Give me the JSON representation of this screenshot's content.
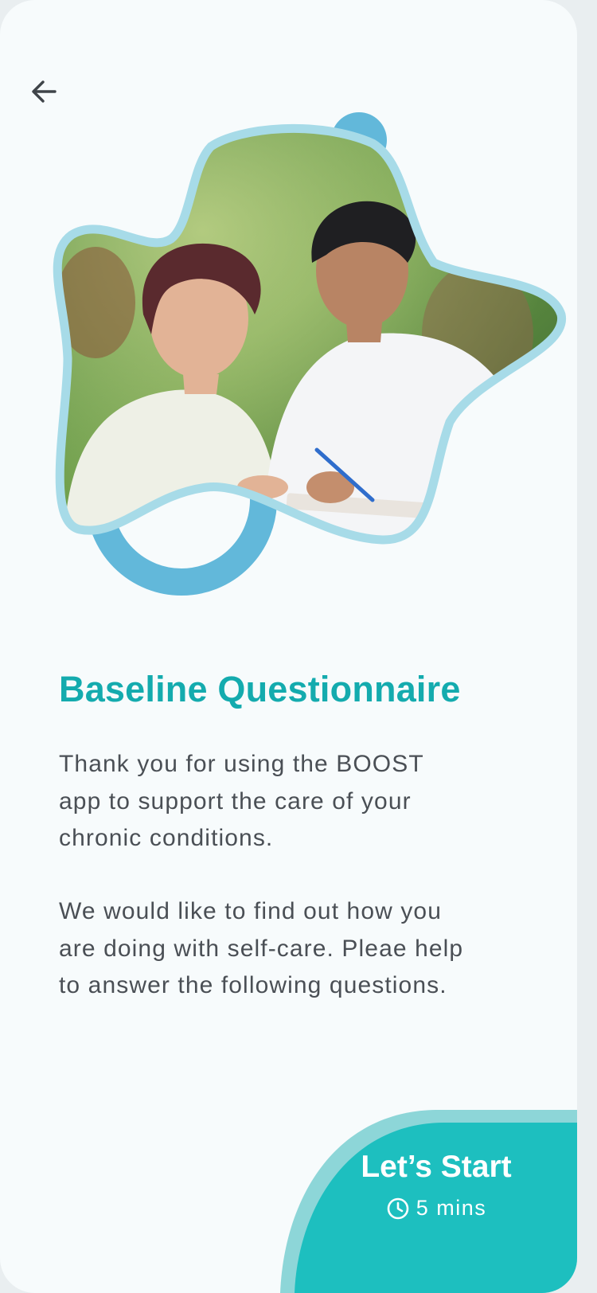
{
  "header": {
    "back_icon": "arrow-left-icon"
  },
  "hero": {
    "image_alt": "Smiling woman and man filling in a questionnaire outdoors"
  },
  "content": {
    "title": "Baseline Questionnaire",
    "paragraph_1": "Thank you for using the BOOST app to support the care of your chronic conditions.",
    "paragraph_2": "We would like to find out how you are doing with self-care. Pleae help to answer the following questions."
  },
  "cta": {
    "label": "Let’s Start",
    "duration": "5 mins",
    "duration_icon": "clock-icon"
  },
  "colors": {
    "accent": "#14abae",
    "cta_fill": "#1dbfbf",
    "cta_outer": "#8dd6d8",
    "blob_border": "#a7dbe8",
    "deco_blue": "#62b8da",
    "background": "#f7fbfc",
    "body_text": "#4a4f55"
  }
}
